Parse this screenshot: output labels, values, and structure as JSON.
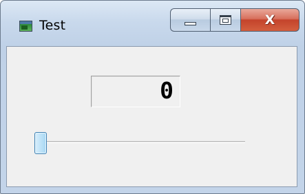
{
  "window": {
    "title": "Test",
    "icons": {
      "app": "app-window-icon",
      "minimize": "minimize-icon",
      "maximize": "maximize-icon",
      "close": "close-icon"
    },
    "close_glyph": "X"
  },
  "display": {
    "value": "0"
  },
  "slider": {
    "value": 0
  },
  "colors": {
    "close_button": "#c4432b",
    "slider_thumb": "#bfe3f8",
    "client_background": "#f0f0f0"
  }
}
